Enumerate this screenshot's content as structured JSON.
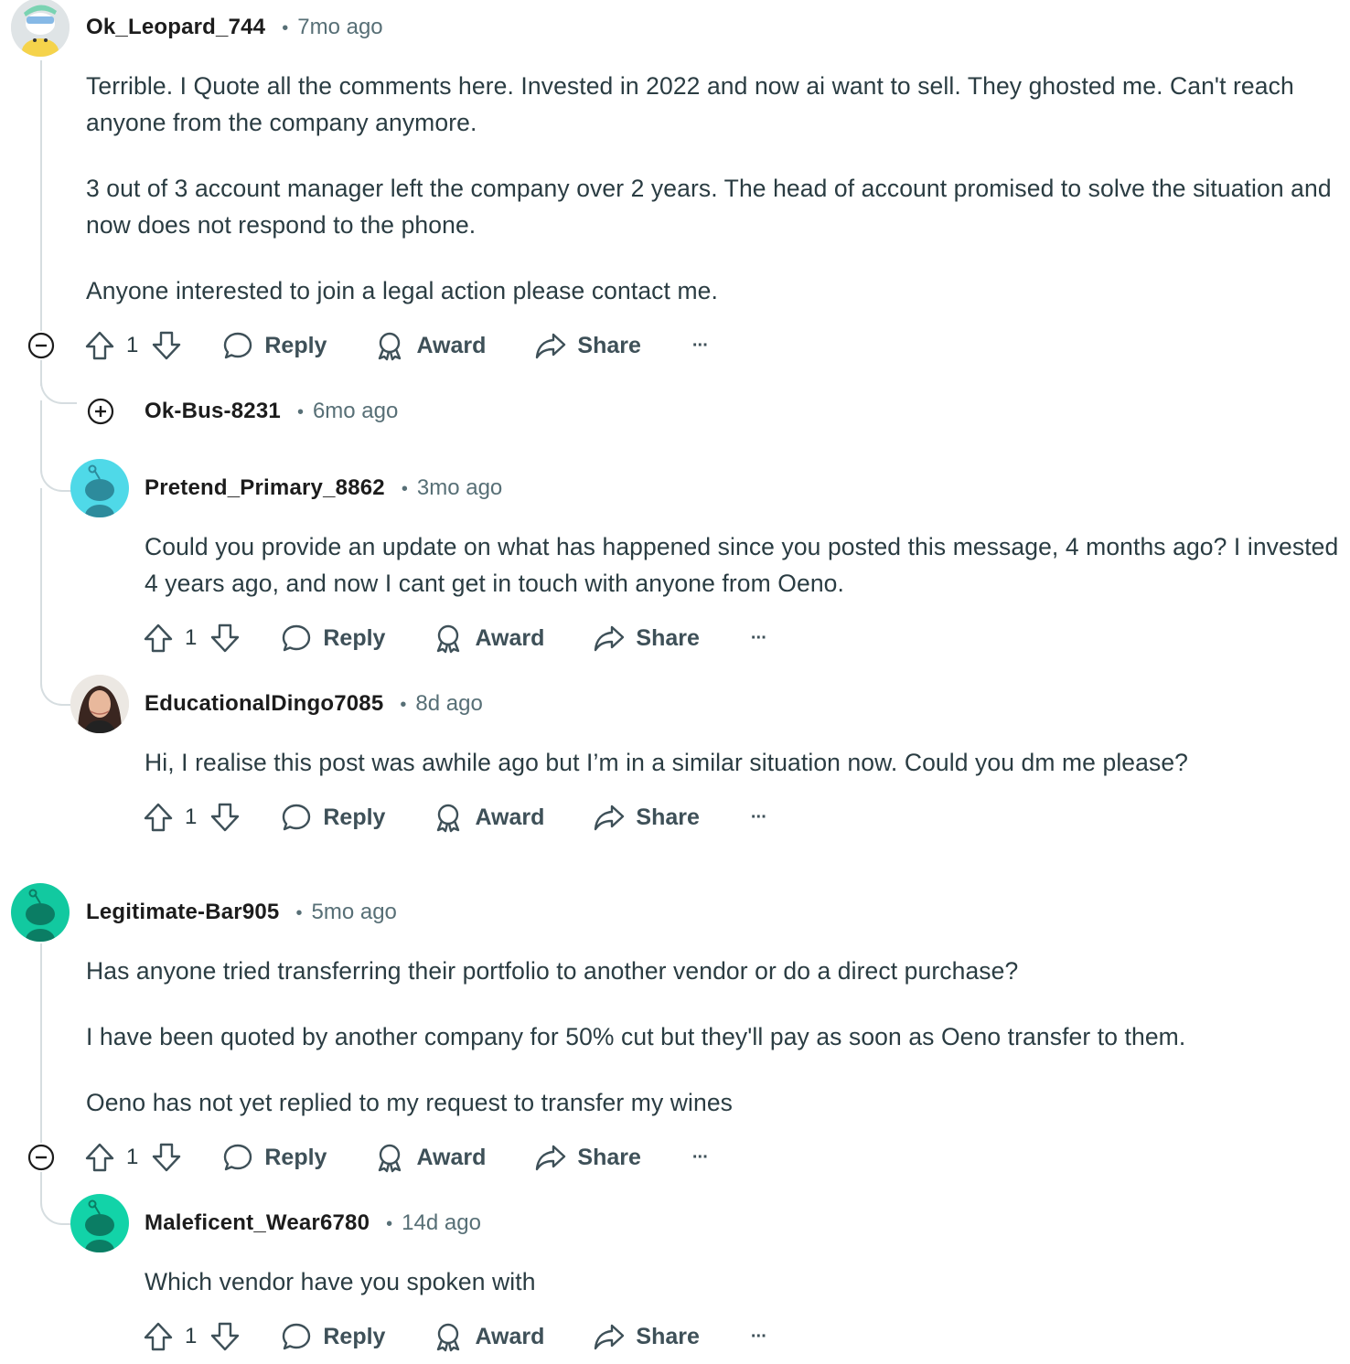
{
  "labels": {
    "reply": "Reply",
    "award": "Award",
    "share": "Share",
    "more": "···"
  },
  "comments": [
    {
      "username": "Ok_Leopard_744",
      "time": "7mo ago",
      "paragraphs": [
        "Terrible. I Quote all the comments here. Invested in 2022 and now ai want to sell. They ghosted me. Can't reach anyone from the company anymore.",
        "3 out of 3 account manager left the company over 2 years. The head of account promised to solve the situation and now does not respond to the phone.",
        "Anyone interested to join a legal action please contact me."
      ],
      "votes": "1"
    },
    {
      "username": "Ok-Bus-8231",
      "time": "6mo ago",
      "collapsed": true
    },
    {
      "username": "Pretend_Primary_8862",
      "time": "3mo ago",
      "paragraphs": [
        "Could you provide an update on what has happened since you posted this message, 4 months ago? I invested 4 years ago, and now I cant get in touch with anyone from Oeno."
      ],
      "votes": "1"
    },
    {
      "username": "EducationalDingo7085",
      "time": "8d ago",
      "paragraphs": [
        "Hi, I realise this post was awhile ago but I’m in a similar situation now. Could you dm me please?"
      ],
      "votes": "1"
    },
    {
      "username": "Legitimate-Bar905",
      "time": "5mo ago",
      "paragraphs": [
        "Has anyone tried transferring their portfolio to another vendor or do a direct purchase?",
        "I have been quoted by another company for 50% cut but they'll pay as soon as Oeno transfer to them.",
        "Oeno has not yet replied to my request to transfer my wines"
      ],
      "votes": "1"
    },
    {
      "username": "Maleficent_Wear6780",
      "time": "14d ago",
      "paragraphs": [
        "Which vendor have you spoken with"
      ],
      "votes": "1"
    }
  ],
  "colors": {
    "avatar_teal_light": "#4fd9e8",
    "avatar_teal": "#12c9a0",
    "text_meta": "#576f76",
    "thread_line": "#d6dde0"
  }
}
